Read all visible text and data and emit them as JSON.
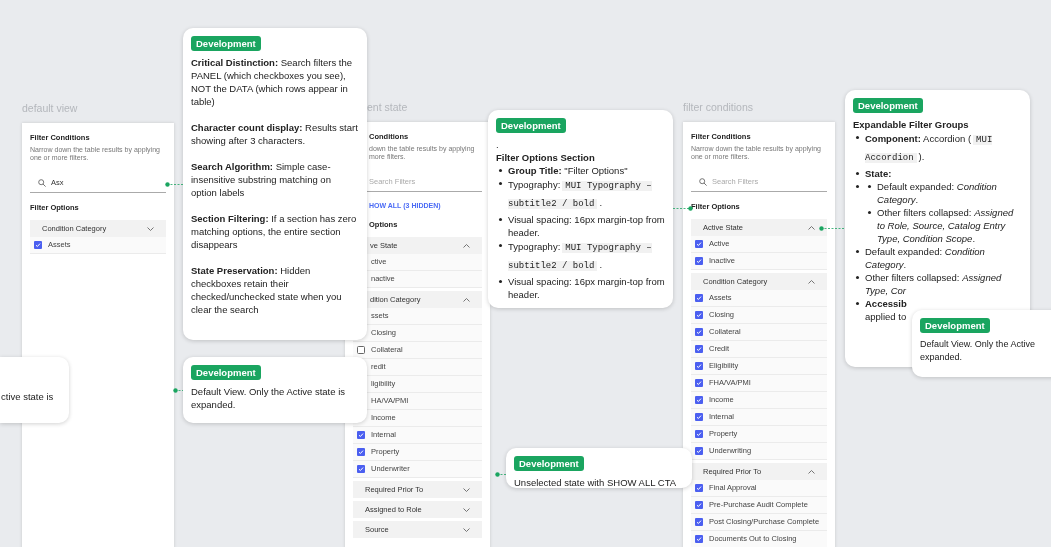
{
  "panels": [
    {
      "label": "default view",
      "title": "Filter Conditions",
      "description": [
        "Narrow down the table results by applying",
        "one or more filters."
      ],
      "search": {
        "value": "Asx"
      },
      "options_title": "Filter Options",
      "groups": [
        {
          "title": "Condition Category",
          "expanded": false,
          "options": [
            {
              "label": "Assets",
              "checked": true
            }
          ]
        }
      ]
    },
    {
      "label": "ent state",
      "title": "Conditions",
      "description": [
        "down the table results by applying",
        "more filters."
      ],
      "search": {
        "placeholder": "Search Filters"
      },
      "show_all": "HOW ALL (3 HIDDEN)",
      "options_title": "Options",
      "groups": [
        {
          "title": "ve State",
          "expanded": true,
          "options": [
            {
              "label": "ctive"
            },
            {
              "label": "nactive"
            }
          ]
        },
        {
          "title": "dition Category",
          "expanded": true,
          "options": [
            {
              "label": "ssets"
            },
            {
              "label": "Closing"
            },
            {
              "label": "Collateral",
              "checked": false
            },
            {
              "label": "redit"
            },
            {
              "label": "ligibility"
            },
            {
              "label": "HA/VA/PMI"
            },
            {
              "label": "Income"
            },
            {
              "label": "Internal",
              "checked": true
            },
            {
              "label": "Property",
              "checked": true
            },
            {
              "label": "Underwriter",
              "checked": true
            }
          ]
        },
        {
          "title": "Required Prior To",
          "expanded": false
        },
        {
          "title": "Assigned to Role",
          "expanded": false
        },
        {
          "title": "Source",
          "expanded": false
        }
      ]
    },
    {
      "label": "filter conditions",
      "title": "Filter Conditions",
      "description": [
        "Narrow down the table results by applying",
        "one or more filters."
      ],
      "search": {
        "placeholder": "Search Filters"
      },
      "options_title": "Filter Options",
      "groups": [
        {
          "title": "Active State",
          "expanded": true,
          "options": [
            {
              "label": "Active",
              "checked": true
            },
            {
              "label": "Inactive",
              "checked": true
            }
          ]
        },
        {
          "title": "Condition Category",
          "expanded": true,
          "options": [
            {
              "label": "Assets",
              "checked": true
            },
            {
              "label": "Closing",
              "checked": true
            },
            {
              "label": "Collateral",
              "checked": true
            },
            {
              "label": "Credit",
              "checked": true
            },
            {
              "label": "Eligibility",
              "checked": true
            },
            {
              "label": "FHA/VA/PMI",
              "checked": true
            },
            {
              "label": "Income",
              "checked": true
            },
            {
              "label": "Internal",
              "checked": true
            },
            {
              "label": "Property",
              "checked": true
            },
            {
              "label": "Underwriting",
              "checked": true
            }
          ]
        },
        {
          "title": "Required Prior To",
          "expanded": true,
          "options": [
            {
              "label": "Final Approval",
              "checked": true
            },
            {
              "label": "Pre-Purchase Audit Complete",
              "checked": true
            },
            {
              "label": "Post Closing/Purchase Complete",
              "checked": true
            },
            {
              "label": "Documents Out to Closing",
              "checked": true
            }
          ]
        }
      ]
    }
  ],
  "notes": [
    {
      "badge": "Development",
      "blocks": [
        {
          "kind": "para",
          "parts": [
            {
              "kind": "text",
              "text": "**Critical Distinction:** Search filters the PANEL (which checkboxes you see), NOT the DATA (which rows appear in table)"
            }
          ]
        },
        {
          "kind": "para",
          "parts": [
            {
              "kind": "text",
              "text": "**Character count display:** Results start showing after 3 characters."
            }
          ]
        },
        {
          "kind": "para",
          "parts": [
            {
              "kind": "text",
              "text": "**Search Algorithm:** Simple case-insensitive substring matching on option labels"
            }
          ]
        },
        {
          "kind": "para",
          "parts": [
            {
              "kind": "text",
              "text": "**Section Filtering:** If a section has zero matching options, the entire section disappears"
            }
          ]
        },
        {
          "kind": "para",
          "parts": [
            {
              "kind": "text",
              "text": "**State Preservation:** Hidden checkboxes retain their checked/unchecked state when you clear the search"
            }
          ]
        }
      ]
    },
    {
      "badge": "Development",
      "blocks": [
        {
          "kind": "para",
          "parts": [
            {
              "kind": "text",
              "text": "Default View. Only the Active state is expanded."
            }
          ]
        }
      ]
    },
    {
      "blocks": [
        {
          "kind": "para",
          "parts": [
            {
              "kind": "text",
              "text": "ctive state is"
            }
          ]
        }
      ]
    },
    {
      "badge": "Development",
      "blocks": [
        {
          "kind": "line",
          "parts": [
            {
              "kind": "text",
              "text": "."
            }
          ]
        },
        {
          "kind": "heading",
          "parts": [
            {
              "kind": "text",
              "text": "Filter Options Section"
            }
          ]
        },
        {
          "kind": "bullets",
          "items": [
            {
              "parts": [
                {
                  "kind": "text",
                  "text": "**Group Title:** \"Filter Options\""
                }
              ]
            },
            {
              "parts": [
                {
                  "kind": "text",
                  "text": "Typography:"
                },
                {
                  "kind": "code",
                  "text": "MUI Typography – subtitle2 / bold"
                },
                {
                  "kind": "text",
                  "text": "."
                }
              ]
            },
            {
              "parts": [
                {
                  "kind": "text",
                  "text": "Visual spacing: 16px margin-top from header."
                }
              ]
            },
            {
              "parts": [
                {
                  "kind": "text",
                  "text": "Typography:"
                },
                {
                  "kind": "code",
                  "text": "MUI Typography – subtitle2 / bold"
                },
                {
                  "kind": "text",
                  "text": "."
                }
              ]
            },
            {
              "parts": [
                {
                  "kind": "text",
                  "text": "Visual spacing: 16px margin-top from header."
                }
              ]
            }
          ]
        }
      ]
    },
    {
      "badge": "Development",
      "blocks": [
        {
          "kind": "para",
          "parts": [
            {
              "kind": "text",
              "text": "Unselected state with SHOW ALL CTA"
            }
          ]
        }
      ]
    },
    {
      "badge": "Development",
      "blocks": [
        {
          "kind": "heading",
          "parts": [
            {
              "kind": "text",
              "text": "Expandable Filter Groups"
            }
          ]
        },
        {
          "kind": "bullets",
          "items": [
            {
              "parts": [
                {
                  "kind": "text",
                  "text": "**Component:** Accordion ("
                },
                {
                  "kind": "code",
                  "text": "MUI Accordion"
                },
                {
                  "kind": "text",
                  "text": ")."
                }
              ]
            },
            {
              "parts": [
                {
                  "kind": "text",
                  "text": "**State:**"
                }
              ]
            },
            {
              "children": [
                {
                  "parts": [
                    {
                      "kind": "text",
                      "text": "Default expanded: *Condition Category*."
                    }
                  ]
                },
                {
                  "parts": [
                    {
                      "kind": "text",
                      "text": "Other filters collapsed: *Assigned to Role, Source, Catalog Entry Type, Condition Scope*."
                    }
                  ]
                }
              ]
            },
            {
              "parts": [
                {
                  "kind": "text",
                  "text": "Default expanded: *Condition Category*."
                }
              ]
            },
            {
              "parts": [
                {
                  "kind": "text",
                  "text": "Other filters collapsed: *Assigned*"
                },
                {
                  "kind": "break"
                },
                {
                  "kind": "text",
                  "text": "*Type, Cor*"
                }
              ]
            },
            {
              "parts": [
                {
                  "kind": "text",
                  "text": "**Accessib**"
                },
                {
                  "kind": "break"
                },
                {
                  "kind": "text",
                  "text": "applied to"
                }
              ]
            }
          ]
        }
      ]
    },
    {
      "badge": "Development",
      "blocks": [
        {
          "kind": "para",
          "parts": [
            {
              "kind": "text",
              "text": "Default View. Only the Active"
            },
            {
              "kind": "break"
            },
            {
              "kind": "text",
              "text": "expanded."
            }
          ]
        }
      ]
    }
  ]
}
